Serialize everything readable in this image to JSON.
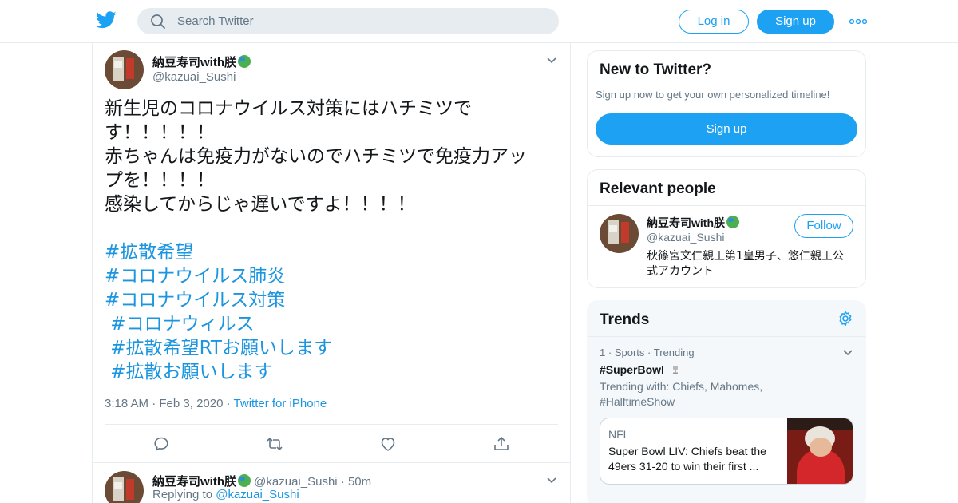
{
  "header": {
    "search_placeholder": "Search Twitter",
    "login_label": "Log in",
    "signup_label": "Sign up",
    "brand_color": "#1da1f2"
  },
  "tweet": {
    "author_name": "納豆寿司with朕",
    "author_handle": "@kazuai_Sushi",
    "text_lines": [
      "新生児のコロナウイルス対策にはハチミツで",
      "す！！！！！",
      "赤ちゃんは免疫力がないのでハチミツで免疫力アッ",
      "プを！！！！",
      "感染してからじゃ遅いですよ！！！！"
    ],
    "hashtags": [
      "#拡散希望",
      "#コロナウイルス肺炎",
      "#コロナウイルス対策",
      " #コロナウィルス",
      " #拡散希望RTお願いします",
      " #拡散お願いします"
    ],
    "time": "3:18 AM",
    "date": "Feb 3, 2020",
    "source": "Twitter for iPhone",
    "actions": [
      "reply-icon",
      "retweet-icon",
      "like-icon",
      "share-icon"
    ]
  },
  "reply": {
    "author_name": "納豆寿司with朕",
    "author_handle": "@kazuai_Sushi",
    "age": "50m",
    "replying_to_label": "Replying to",
    "replying_to_handle": "@kazuai_Sushi"
  },
  "sidebar": {
    "new_card": {
      "title": "New to Twitter?",
      "subtitle": "Sign up now to get your own personalized timeline!",
      "signup_label": "Sign up"
    },
    "relevant": {
      "title": "Relevant people",
      "name": "納豆寿司with朕",
      "handle": "@kazuai_Sushi",
      "follow_label": "Follow",
      "bio": "秋篠宮文仁親王第1皇男子、悠仁親王公式アカウント"
    },
    "trends": {
      "title": "Trends",
      "items": [
        {
          "rank": "1",
          "category": "Sports",
          "status": "Trending",
          "name": "#SuperBowl",
          "trending_with": "Trending with: Chiefs, Mahomes, #HalftimeShow",
          "news_source": "NFL",
          "news_headline": "Super Bowl LIV: Chiefs beat the 49ers 31-20 to win their first ..."
        }
      ]
    }
  }
}
